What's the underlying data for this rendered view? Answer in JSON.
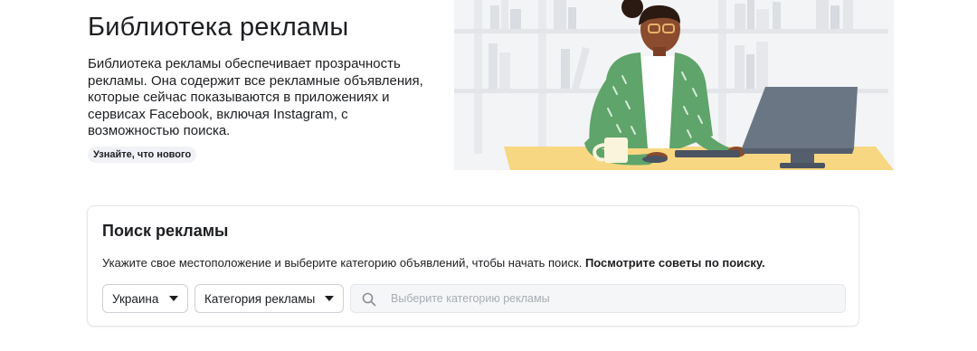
{
  "hero": {
    "title": "Библиотека рекламы",
    "description": "Библиотека рекламы обеспечивает прозрачность рекламы. Она содержит все рекламные объявления, которые сейчас показываются в приложениях и сервисах Facebook, включая Instagram, с возможностью поиска.",
    "whats_new": "Узнайте, что нового"
  },
  "search": {
    "title": "Поиск рекламы",
    "hint": "Укажите свое местоположение и выберите категорию объявлений, чтобы начать поиск.",
    "hint_link": "Посмотрите советы по поиску.",
    "country": "Украина",
    "category": "Категория рекламы",
    "placeholder": "Выберите категорию рекламы"
  },
  "icons": {
    "country_caret": "caret-down-icon",
    "category_caret": "caret-down-icon",
    "search": "search-icon"
  },
  "colors": {
    "text": "#1c1e21",
    "muted": "#a8adb4",
    "jacket": "#5fa46a",
    "skin": "#8a4b2e",
    "desk": "#f7d781",
    "monitor": "#6b7685"
  }
}
